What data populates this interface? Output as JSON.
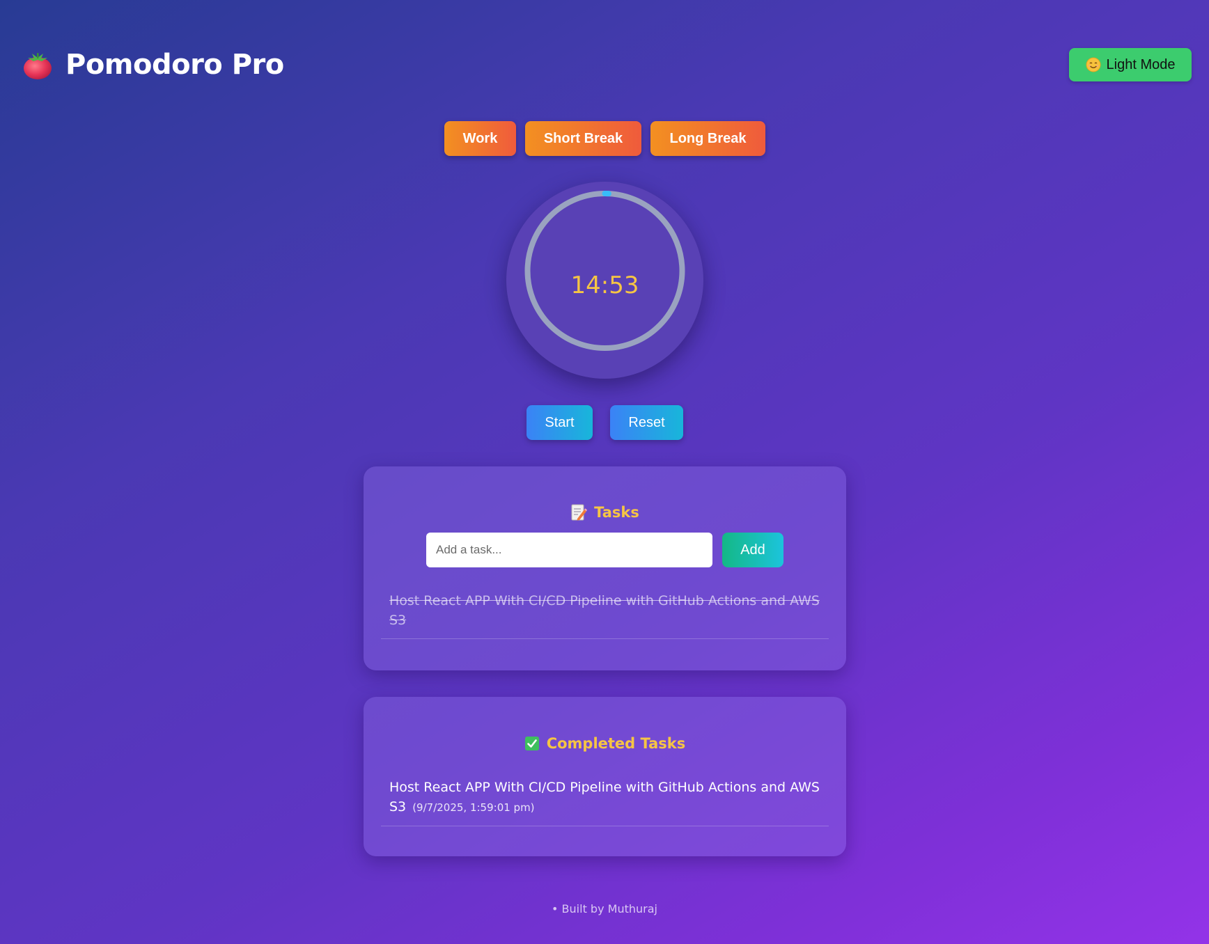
{
  "header": {
    "title": "Pomodoro Pro",
    "logo_icon": "tomato-icon",
    "theme_toggle_label": "Light Mode",
    "theme_toggle_icon": "smiling-face-icon"
  },
  "modes": {
    "work_label": "Work",
    "short_break_label": "Short Break",
    "long_break_label": "Long Break"
  },
  "timer": {
    "display": "14:53",
    "progress": 0.0078
  },
  "controls": {
    "start_label": "Start",
    "reset_label": "Reset"
  },
  "tasks": {
    "heading": "Tasks",
    "heading_icon": "memo-icon",
    "input_placeholder": "Add a task...",
    "input_value": "",
    "add_label": "Add",
    "items": [
      {
        "text": "Host React APP With CI/CD Pipeline with GitHub Actions and AWS S3",
        "completed": true
      }
    ]
  },
  "completed_tasks": {
    "heading": "Completed Tasks",
    "heading_icon": "check-mark-icon",
    "items": [
      {
        "text": "Host React APP With CI/CD Pipeline with GitHub Actions and AWS S3",
        "timestamp": "(9/7/2025, 1:59:01 pm)"
      }
    ]
  },
  "footer": {
    "text": "• Built by Muthuraj"
  },
  "colors": {
    "accent_timer": "#f6c544",
    "heading": "#f6c544",
    "toggle_bg": "#3ccc6e",
    "mode_gradient_start": "#f39021",
    "mode_gradient_end": "#ef5b3c",
    "control_gradient_start": "#3b82f6",
    "control_gradient_end": "#18b6da",
    "progress_track": "#9aa3c0",
    "progress_fill": "#38bdf8"
  }
}
